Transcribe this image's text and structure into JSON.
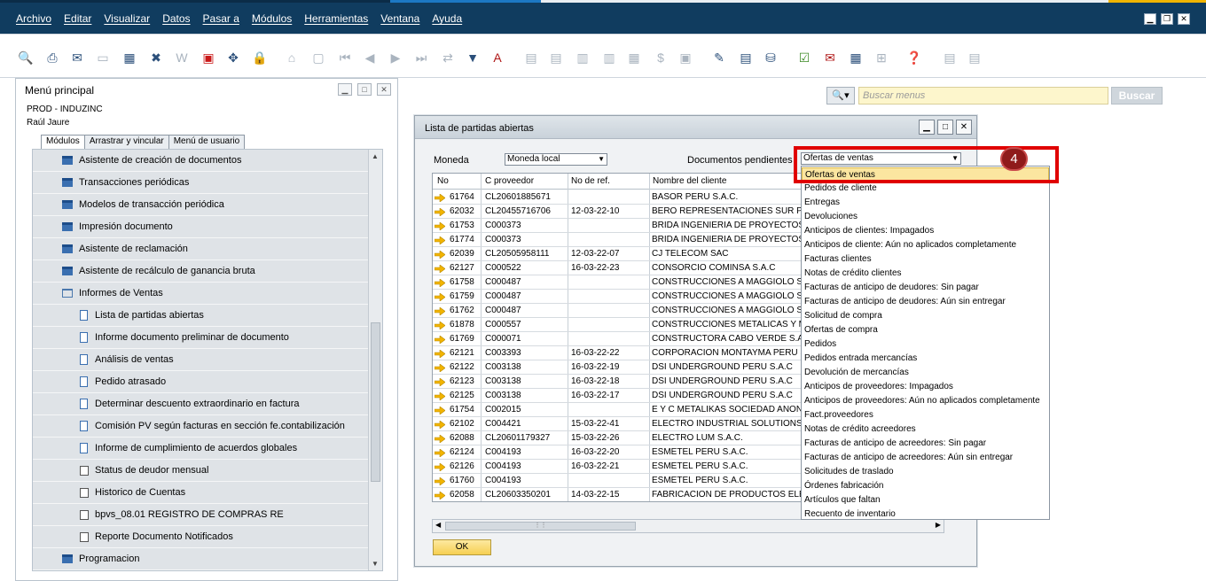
{
  "menubar": {
    "items": [
      "Archivo",
      "Editar",
      "Visualizar",
      "Datos",
      "Pasar a",
      "Módulos",
      "Herramientas",
      "Ventana",
      "Ayuda"
    ]
  },
  "main_menu": {
    "title": "Menú principal",
    "company": "PROD - INDUZINC",
    "user": "Raúl Jaure",
    "tabs": [
      "Módulos",
      "Arrastrar y vincular",
      "Menú de usuario"
    ],
    "items": [
      {
        "label": "Asistente de creación de documentos",
        "icon": "window-icon",
        "level": 0
      },
      {
        "label": "Transacciones periódicas",
        "icon": "window-icon",
        "level": 0
      },
      {
        "label": "Modelos de transacción periódica",
        "icon": "window-icon",
        "level": 0
      },
      {
        "label": "Impresión documento",
        "icon": "window-icon",
        "level": 0
      },
      {
        "label": "Asistente de reclamación",
        "icon": "window-icon",
        "level": 0
      },
      {
        "label": "Asistente de recálculo de ganancia bruta",
        "icon": "window-icon",
        "level": 0
      },
      {
        "label": "Informes de Ventas",
        "icon": "folder-open-icon",
        "level": 0
      },
      {
        "label": "Lista de partidas abiertas",
        "icon": "document-icon",
        "level": 1
      },
      {
        "label": "Informe documento preliminar de documento",
        "icon": "document-icon",
        "level": 1
      },
      {
        "label": "Análisis de ventas",
        "icon": "document-icon",
        "level": 1
      },
      {
        "label": "Pedido atrasado",
        "icon": "document-icon",
        "level": 1
      },
      {
        "label": "Determinar descuento extraordinario en factura",
        "icon": "document-icon",
        "level": 1
      },
      {
        "label": "Comisión PV según facturas en sección fe.contabilización",
        "icon": "document-icon",
        "level": 1
      },
      {
        "label": "Informe de cumplimiento de acuerdos globales",
        "icon": "document-icon",
        "level": 1
      },
      {
        "label": "Status de deudor mensual",
        "icon": "report-icon",
        "level": 1
      },
      {
        "label": "Historico de Cuentas",
        "icon": "report-icon",
        "level": 1
      },
      {
        "label": "bpvs_08.01 REGISTRO DE COMPRAS RE",
        "icon": "report-icon",
        "level": 1
      },
      {
        "label": "Reporte Documento Notificados",
        "icon": "report-icon",
        "level": 1
      },
      {
        "label": "Programacion",
        "icon": "window-icon",
        "level": 0
      }
    ]
  },
  "search": {
    "placeholder": "Buscar menus",
    "button": "Buscar"
  },
  "dialog": {
    "title": "Lista de partidas abiertas",
    "moneda_label": "Moneda",
    "moneda_value": "Moneda local",
    "docs_label": "Documentos pendientes",
    "docs_value": "Ofertas de ventas",
    "ok_label": "OK",
    "columns": [
      "No",
      "C proveedor",
      "No de ref.",
      "Nombre del cliente"
    ],
    "rows": [
      {
        "no": "61764",
        "cprov": "CL20601885671",
        "ref": "",
        "cliente": "BASOR PERU S.A.C."
      },
      {
        "no": "62032",
        "cprov": "CL20455716706",
        "ref": "12-03-22-10",
        "cliente": "BERO REPRESENTACIONES SUR PER"
      },
      {
        "no": "61753",
        "cprov": "C000373",
        "ref": "",
        "cliente": "BRIDA INGENIERIA DE PROYECTOS"
      },
      {
        "no": "61774",
        "cprov": "C000373",
        "ref": "",
        "cliente": "BRIDA INGENIERIA DE PROYECTOS"
      },
      {
        "no": "62039",
        "cprov": "CL20505958111",
        "ref": "12-03-22-07",
        "cliente": "CJ TELECOM SAC"
      },
      {
        "no": "62127",
        "cprov": "C000522",
        "ref": "16-03-22-23",
        "cliente": "CONSORCIO COMINSA S.A.C"
      },
      {
        "no": "61758",
        "cprov": "C000487",
        "ref": "",
        "cliente": "CONSTRUCCIONES A MAGGIOLO S"
      },
      {
        "no": "61759",
        "cprov": "C000487",
        "ref": "",
        "cliente": "CONSTRUCCIONES A MAGGIOLO S"
      },
      {
        "no": "61762",
        "cprov": "C000487",
        "ref": "",
        "cliente": "CONSTRUCCIONES A MAGGIOLO S"
      },
      {
        "no": "61878",
        "cprov": "C000557",
        "ref": "",
        "cliente": "CONSTRUCCIONES METALICAS Y M"
      },
      {
        "no": "61769",
        "cprov": "C000071",
        "ref": "",
        "cliente": "CONSTRUCTORA CABO VERDE S.A"
      },
      {
        "no": "62121",
        "cprov": "C003393",
        "ref": "16-03-22-22",
        "cliente": "CORPORACION MONTAYMA PERU S"
      },
      {
        "no": "62122",
        "cprov": "C003138",
        "ref": "16-03-22-19",
        "cliente": "DSI UNDERGROUND PERU S.A.C"
      },
      {
        "no": "62123",
        "cprov": "C003138",
        "ref": "16-03-22-18",
        "cliente": "DSI UNDERGROUND PERU S.A.C"
      },
      {
        "no": "62125",
        "cprov": "C003138",
        "ref": "16-03-22-17",
        "cliente": "DSI UNDERGROUND PERU S.A.C"
      },
      {
        "no": "61754",
        "cprov": "C002015",
        "ref": "",
        "cliente": "E Y C METALIKAS SOCIEDAD ANON"
      },
      {
        "no": "62102",
        "cprov": "C004421",
        "ref": "15-03-22-41",
        "cliente": "ELECTRO INDUSTRIAL SOLUTIONS"
      },
      {
        "no": "62088",
        "cprov": "CL20601179327",
        "ref": "15-03-22-26",
        "cliente": "ELECTRO LUM S.A.C."
      },
      {
        "no": "62124",
        "cprov": "C004193",
        "ref": "16-03-22-20",
        "cliente": "ESMETEL PERU S.A.C."
      },
      {
        "no": "62126",
        "cprov": "C004193",
        "ref": "16-03-22-21",
        "cliente": "ESMETEL PERU S.A.C."
      },
      {
        "no": "61760",
        "cprov": "C004193",
        "ref": "",
        "cliente": "ESMETEL PERU S.A.C."
      },
      {
        "no": "62058",
        "cprov": "CL20603350201",
        "ref": "14-03-22-15",
        "cliente": "FABRICACION DE PRODUCTOS ELE"
      }
    ]
  },
  "dropdown": {
    "options": [
      "Ofertas de ventas",
      "Pedidos de cliente",
      "Entregas",
      "Devoluciones",
      "Anticipos de clientes: Impagados",
      "Anticipos de cliente: Aún no aplicados completamente",
      "Facturas clientes",
      "Notas de crédito clientes",
      "Facturas de anticipo de deudores: Sin pagar",
      "Facturas de anticipo de deudores: Aún sin entregar",
      "Solicitud de compra",
      "Ofertas de compra",
      "Pedidos",
      "Pedidos entrada mercancías",
      "Devolución de mercancías",
      "Anticipos de proveedores: Impagados",
      "Anticipos de proveedores: Aún no aplicados completamente",
      "Fact.proveedores",
      "Notas de crédito acreedores",
      "Facturas de anticipo de acreedores: Sin pagar",
      "Facturas de anticipo de acreedores: Aún sin entregar",
      "Solicitudes de traslado",
      "Órdenes fabricación",
      "Artículos que faltan",
      "Recuento de inventario"
    ],
    "selected_index": 0
  },
  "annotation": {
    "badge": "4",
    "color": "#e00000"
  },
  "colors": {
    "menubar_bg": "#103c5f",
    "accent_yellow": "#f6cf52",
    "highlight_red": "#e00000"
  }
}
